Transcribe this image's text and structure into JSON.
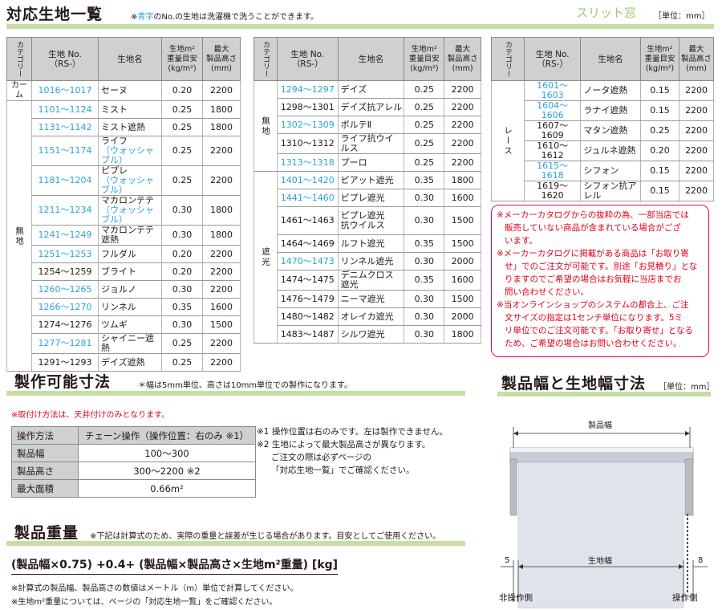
{
  "header": {
    "title": "対応生地一覧",
    "note_prefix": "※",
    "note_blue": "青字",
    "note_rest": "のNo.の生地は洗濯機で洗うことができます。",
    "subtitle": "スリット窓",
    "unit": "［単位：mm］"
  },
  "table_headers": {
    "category": "カテゴリー",
    "no_line1": "生地 No.",
    "no_line2": "（RS-）",
    "name": "生地名",
    "weight_line1": "生地m²",
    "weight_line2": "重量目安",
    "weight_line3": "(kg/m²)",
    "height_line1": "最大",
    "height_line2": "製品高さ",
    "height_line3": "(mm)"
  },
  "table1": {
    "cat_came": "カーム",
    "cat_muji": "無地",
    "rows": [
      {
        "no": "1016～1017",
        "blue": true,
        "name": "セーヌ",
        "weight": "0.20",
        "height": "2200"
      },
      {
        "no": "1101～1124",
        "blue": true,
        "name": "ミスト",
        "weight": "0.25",
        "height": "1800"
      },
      {
        "no": "1131～1142",
        "blue": true,
        "name": "ミスト遮熱",
        "weight": "0.25",
        "height": "1800"
      },
      {
        "no": "1151～1174",
        "blue": true,
        "name": "ライフ",
        "sub": "（ウォッシャブル）",
        "weight": "0.25",
        "height": "2200"
      },
      {
        "no": "1181～1204",
        "blue": true,
        "name": "ピプレ",
        "sub": "（ウォッシャブル）",
        "weight": "0.25",
        "height": "2200"
      },
      {
        "no": "1211～1234",
        "blue": true,
        "name": "マカロンテテ",
        "sub": "（ウォッシャブル）",
        "weight": "0.30",
        "height": "1800"
      },
      {
        "no": "1241～1249",
        "blue": true,
        "name": "マカロンテテ遮熱",
        "weight": "0.30",
        "height": "1800"
      },
      {
        "no": "1251～1253",
        "blue": true,
        "name": "フルダル",
        "weight": "0.20",
        "height": "2200"
      },
      {
        "no": "1254～1259",
        "blue": false,
        "name": "ブライト",
        "weight": "0.20",
        "height": "2200"
      },
      {
        "no": "1260～1265",
        "blue": true,
        "name": "ジョルノ",
        "weight": "0.30",
        "height": "2200"
      },
      {
        "no": "1266～1270",
        "blue": true,
        "name": "リンネル",
        "weight": "0.35",
        "height": "1600"
      },
      {
        "no": "1274～1276",
        "blue": false,
        "name": "ツムギ",
        "weight": "0.30",
        "height": "1500"
      },
      {
        "no": "1277～1281",
        "blue": true,
        "name": "シャイニー遮熱",
        "weight": "0.25",
        "height": "2200"
      },
      {
        "no": "1291～1293",
        "blue": false,
        "name": "デイズ遮熱",
        "weight": "0.25",
        "height": "2200"
      }
    ]
  },
  "table2": {
    "cat_muji": "無地",
    "cat_shako": "遮光",
    "rows": [
      {
        "no": "1294～1297",
        "blue": true,
        "name": "デイズ",
        "weight": "0.25",
        "height": "2200"
      },
      {
        "no": "1298～1301",
        "blue": false,
        "name": "デイズ抗アレル",
        "weight": "0.25",
        "height": "2200"
      },
      {
        "no": "1302～1309",
        "blue": true,
        "name": "ポルテⅡ",
        "weight": "0.25",
        "height": "2200"
      },
      {
        "no": "1310～1312",
        "blue": false,
        "name": "ライフ抗ウイルス",
        "weight": "0.25",
        "height": "2200"
      },
      {
        "no": "1313～1318",
        "blue": true,
        "name": "プーロ",
        "weight": "0.25",
        "height": "2200"
      },
      {
        "no": "1401～1420",
        "blue": true,
        "name": "ピアット遮光",
        "weight": "0.35",
        "height": "1800"
      },
      {
        "no": "1441～1460",
        "blue": true,
        "name": "ピプレ遮光",
        "weight": "0.30",
        "height": "1600"
      },
      {
        "no": "1461～1463",
        "blue": false,
        "name": "ピプレ遮光",
        "name2": "抗ウイルス",
        "weight": "0.30",
        "height": "1500"
      },
      {
        "no": "1464～1469",
        "blue": false,
        "name": "ルフト遮光",
        "weight": "0.35",
        "height": "1500"
      },
      {
        "no": "1470～1473",
        "blue": true,
        "name": "リンネル遮光",
        "weight": "0.30",
        "height": "2000"
      },
      {
        "no": "1474～1475",
        "blue": false,
        "name": "デニムクロス遮光",
        "weight": "0.35",
        "height": "1600"
      },
      {
        "no": "1476～1479",
        "blue": false,
        "name": "ニーマ遮光",
        "weight": "0.30",
        "height": "1500"
      },
      {
        "no": "1480～1482",
        "blue": false,
        "name": "オレイカ遮光",
        "weight": "0.30",
        "height": "2000"
      },
      {
        "no": "1483～1487",
        "blue": false,
        "name": "シルワ遮光",
        "weight": "0.30",
        "height": "1800"
      }
    ]
  },
  "table3": {
    "cat_lace": "レース",
    "rows": [
      {
        "no": "1601～1603",
        "blue": true,
        "name": "ノータ遮熱",
        "weight": "0.15",
        "height": "2200"
      },
      {
        "no": "1604～1606",
        "blue": true,
        "name": "ラナイ遮熱",
        "weight": "0.15",
        "height": "2200"
      },
      {
        "no": "1607～1609",
        "blue": false,
        "name": "マタン遮熱",
        "weight": "0.25",
        "height": "2200"
      },
      {
        "no": "1610～1612",
        "blue": false,
        "name": "ジュルネ遮熱",
        "weight": "0.20",
        "height": "2200"
      },
      {
        "no": "1615～1618",
        "blue": true,
        "name": "シフォン",
        "weight": "0.15",
        "height": "2200"
      },
      {
        "no": "1619～1620",
        "blue": false,
        "name": "シフォン抗アレル",
        "weight": "0.15",
        "height": "2200"
      }
    ]
  },
  "notice": {
    "line1": "※メーカーカタログからの抜粋の為、一部当店では",
    "line2": "販売していない商品が含まれている場合がござ",
    "line3": "います。",
    "line4": "※メーカーカタログに掲載がある商品は「お取り寄",
    "line5": "せ」でのご注文が可能です。別途「お見積り」とな",
    "line6": "りますのでご希望の場合はお気軽に当店までお",
    "line7": "問い合わせください。",
    "line8": "※当オンラインショップのシステムの都合上、ご注",
    "line9": "文サイズの指定は1センチ単位になります。5ミ",
    "line10": "リ単位でのご注文可能です。「お取り寄せ」となる",
    "line11": "ため、ご希望の場合はお問い合わせください。"
  },
  "size_section": {
    "title": "製作可能寸法",
    "note": "＊幅は5mm単位、高さは10mm単位での製作になります。",
    "red_note": "※取付け方法は、天井付けのみとなります。",
    "rows": [
      {
        "label": "操作方法",
        "value": "チェーン操作（操作位置：右のみ ※1）"
      },
      {
        "label": "製品幅",
        "value": "100～300"
      },
      {
        "label": "製品高さ",
        "value": "300～2200 ※2"
      },
      {
        "label": "最大面積",
        "value": "0.66m²"
      }
    ],
    "note1": "※1 操作位置は右のみです。左は製作できません。",
    "note2": "※2 生地によって最大製品高さが異なります。",
    "note3": "ご注文の際は必ずページの",
    "note4": "「対応生地一覧」でご確認ください。"
  },
  "weight_section": {
    "title": "製品重量",
    "note": "※下記は計算式のため、実際の重量と誤差が生じる場合があります。目安としてご使用ください。",
    "formula": "(製品幅×0.75) +0.4+ (製品幅×製品高さ×生地m²重量) [kg]",
    "foot1": "※計算式の製品幅、製品高さの数値はメートル（m）単位で計算してください。",
    "foot2": "※生地m²重量については、ページの「対応生地一覧」をご確認ください。"
  },
  "diagram": {
    "title": "製品幅と生地幅寸法",
    "unit": "［単位：mm］",
    "label_product_width": "製品幅",
    "label_fabric_width": "生地幅",
    "left_dim": "5",
    "right_dim": "8",
    "left_side": "非操作側",
    "right_side": "操作側"
  },
  "colors": {
    "accent_green": "#c5dea6",
    "blue_text": "#2aa3d8",
    "red_text": "#e2001a",
    "notice_border": "#e4007f"
  }
}
